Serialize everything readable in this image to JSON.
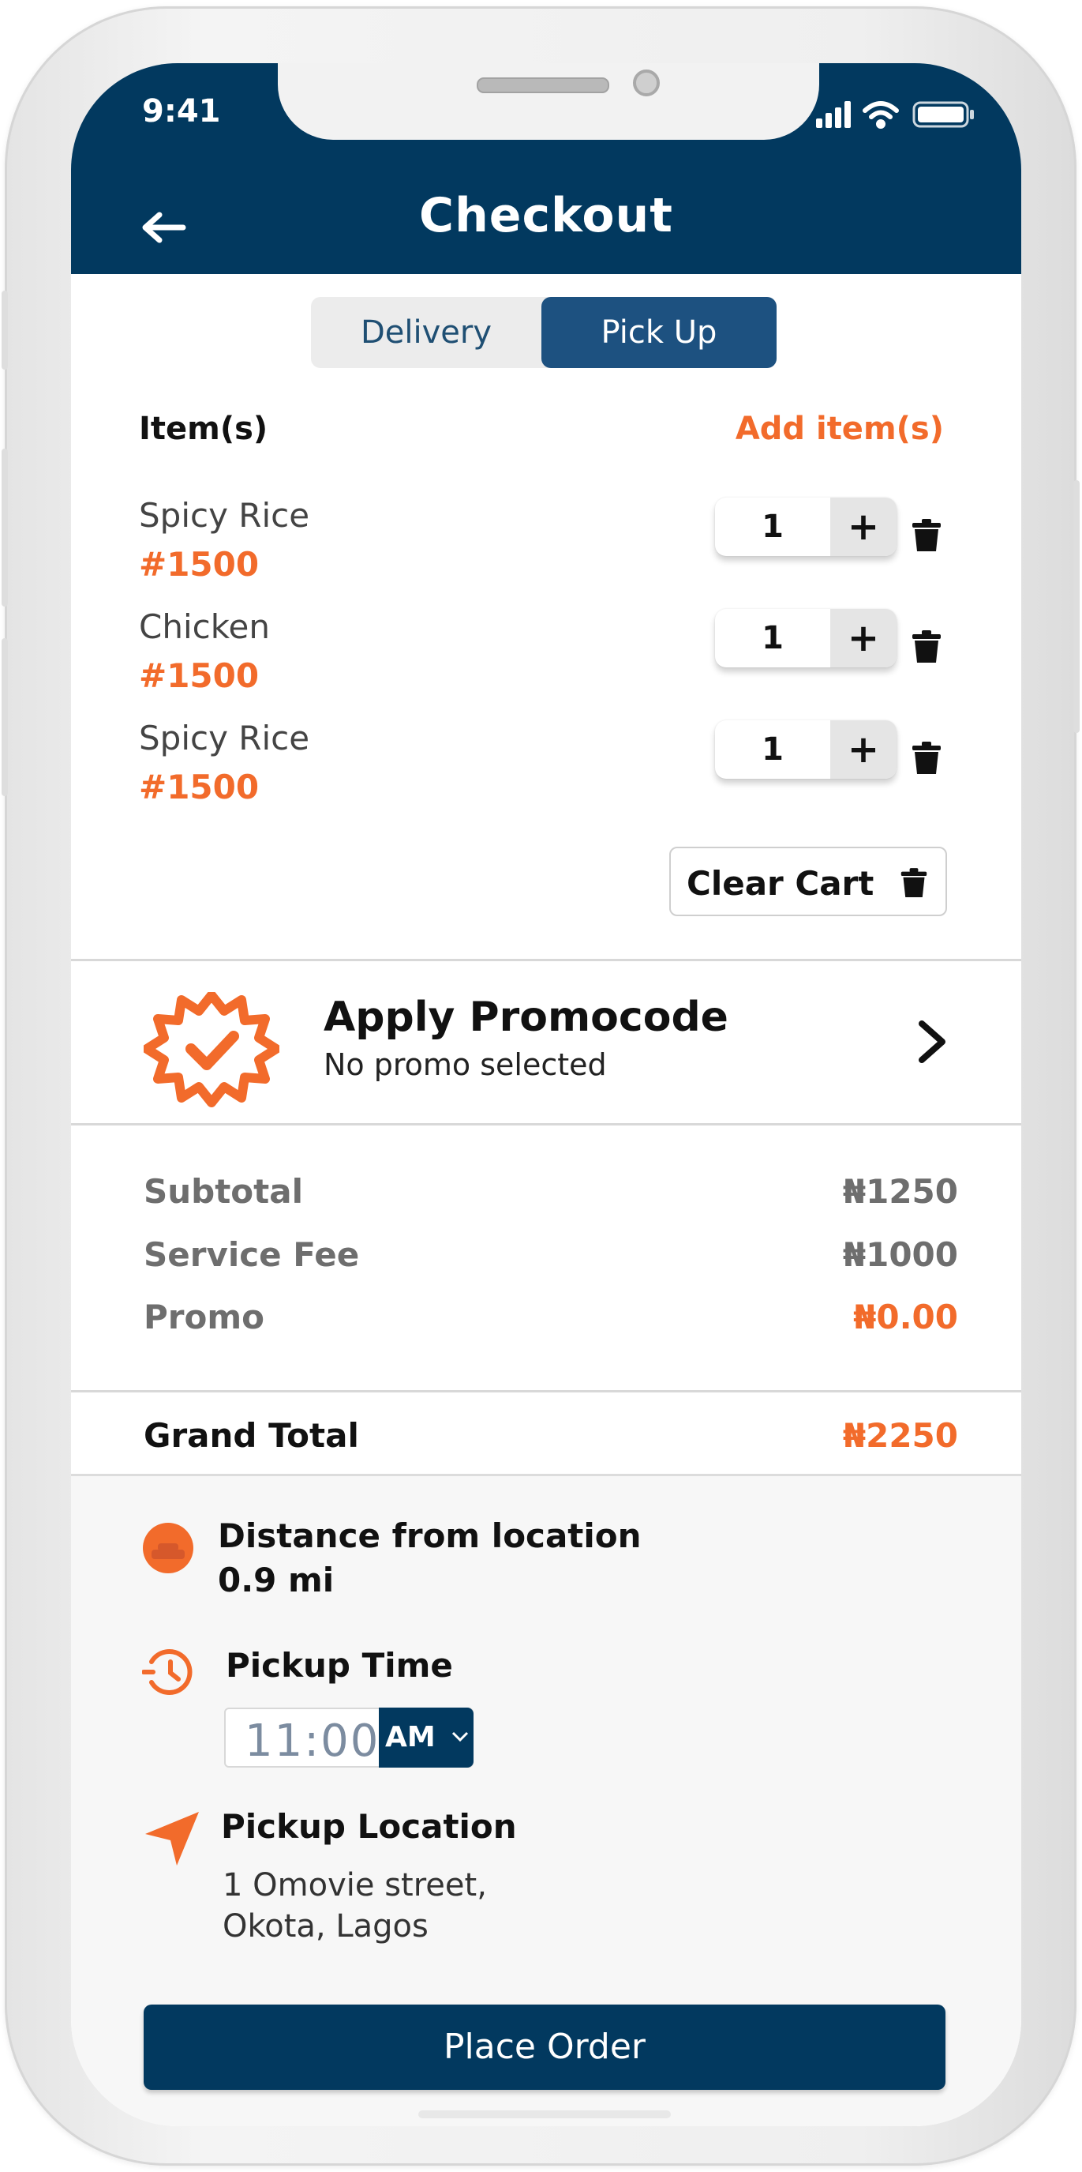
{
  "status_bar": {
    "time": "9:41"
  },
  "header": {
    "title": "Checkout"
  },
  "order_type": {
    "tabs": [
      "Delivery",
      "Pick Up"
    ],
    "selected": "Pick Up"
  },
  "items_section": {
    "heading": "Item(s)",
    "add_link": "Add item(s)"
  },
  "items": [
    {
      "name": "Spicy Rice",
      "price": "#1500",
      "qty": "1"
    },
    {
      "name": "Chicken",
      "price": "#1500",
      "qty": "1"
    },
    {
      "name": "Spicy Rice",
      "price": "#1500",
      "qty": "1"
    }
  ],
  "clear_cart_label": "Clear Cart",
  "promo": {
    "title": "Apply Promocode",
    "subtitle": "No promo selected"
  },
  "summary": {
    "subtotal_label": "Subtotal",
    "subtotal_value": "₦1250",
    "service_fee_label": "Service Fee",
    "service_fee_value": "₦1000",
    "promo_label": "Promo",
    "promo_value": "₦0.00",
    "grand_total_label": "Grand Total",
    "grand_total_value": "₦2250"
  },
  "distance": {
    "title": "Distance from location",
    "value": "0.9 mi"
  },
  "pickup_time": {
    "title": "Pickup Time",
    "time": "11:00",
    "period": "AM"
  },
  "pickup_location": {
    "title": "Pickup Location",
    "line1": "1 Omovie street,",
    "line2": "Okota, Lagos"
  },
  "place_order_label": "Place Order",
  "colors": {
    "primary": "#02395f",
    "accent": "#f26b2b"
  },
  "icons": [
    "back-arrow-icon",
    "signal-icon",
    "wifi-icon",
    "battery-icon",
    "plus-icon",
    "trash-icon",
    "promo-badge-icon",
    "chevron-right-icon",
    "distance-icon",
    "clock-icon",
    "location-arrow-icon",
    "chevron-down-icon"
  ]
}
